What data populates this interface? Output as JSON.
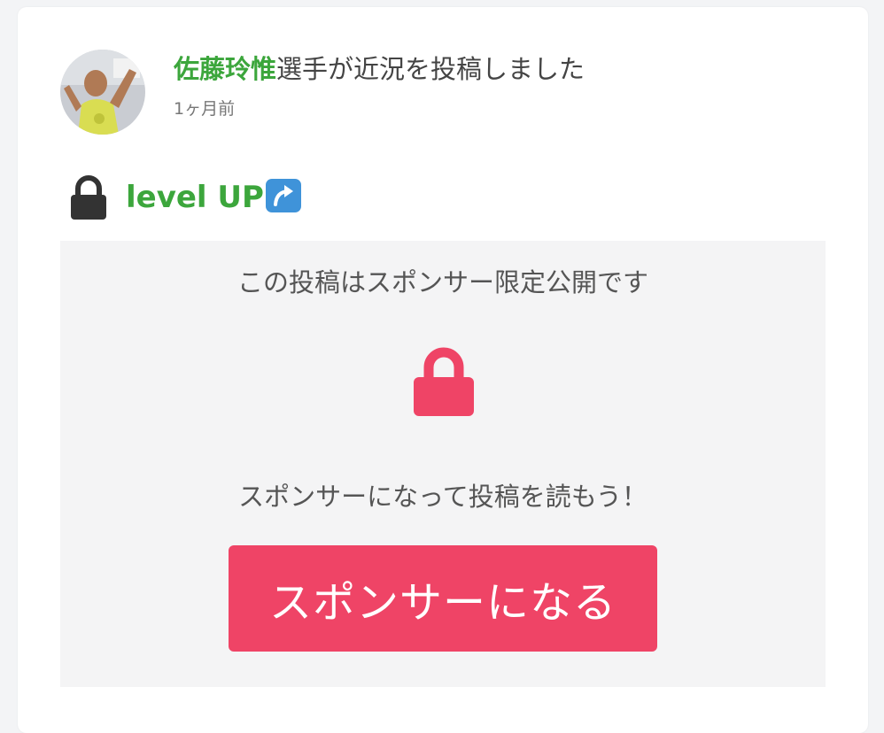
{
  "post": {
    "athlete_name": "佐藤玲惟",
    "headline_suffix": "選手が近況を投稿しました",
    "timestamp": "1ヶ月前",
    "title": "level UP",
    "title_icon": "up-arrow-emoji-icon"
  },
  "locked": {
    "message": "この投稿はスポンサー限定公開です",
    "cta_text": "スポンサーになって投稿を読もう！",
    "button_label": "スポンサーになる",
    "lock_icon": "lock-icon"
  },
  "colors": {
    "accent_green": "#3ca63c",
    "accent_pink": "#ef4466",
    "locked_bg": "#f4f4f5"
  }
}
